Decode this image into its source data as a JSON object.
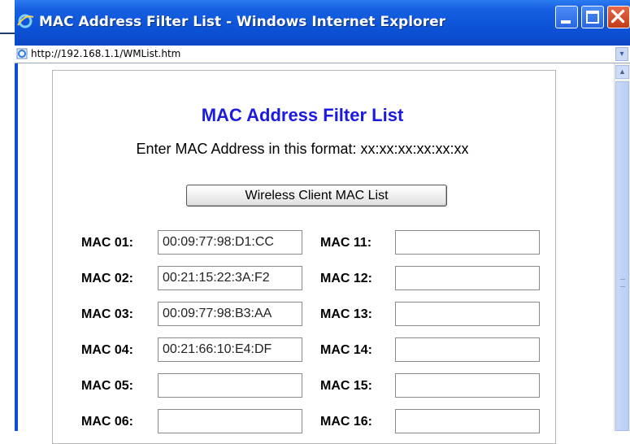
{
  "window": {
    "title": "MAC Address Filter List - Windows Internet Explorer",
    "url": "http://192.168.1.1/WMList.htm"
  },
  "page": {
    "title": "MAC Address Filter List",
    "format_text": "Enter MAC Address in this format: xx:xx:xx:xx:xx:xx",
    "button_label": "Wireless Client MAC List"
  },
  "mac_left": [
    {
      "label": "MAC 01:",
      "value": "00:09:77:98:D1:CC"
    },
    {
      "label": "MAC 02:",
      "value": "00:21:15:22:3A:F2"
    },
    {
      "label": "MAC 03:",
      "value": "00:09:77:98:B3:AA"
    },
    {
      "label": "MAC 04:",
      "value": "00:21:66:10:E4:DF"
    },
    {
      "label": "MAC 05:",
      "value": ""
    },
    {
      "label": "MAC 06:",
      "value": ""
    }
  ],
  "mac_right": [
    {
      "label": "MAC 11:",
      "value": ""
    },
    {
      "label": "MAC 12:",
      "value": ""
    },
    {
      "label": "MAC 13:",
      "value": ""
    },
    {
      "label": "MAC 14:",
      "value": ""
    },
    {
      "label": "MAC 15:",
      "value": ""
    },
    {
      "label": "MAC 16:",
      "value": ""
    }
  ],
  "icons": {
    "window": "ie-logo-icon",
    "address": "ie-page-icon",
    "minimize": "minimize-icon",
    "maximize": "maximize-icon",
    "close": "close-icon",
    "dropdown": "chevron-down-icon",
    "scroll_up": "chevron-up-icon"
  },
  "colors": {
    "title_bar": "#0d53d8",
    "page_title": "#1a1ae0",
    "close_button": "#c13b17"
  }
}
